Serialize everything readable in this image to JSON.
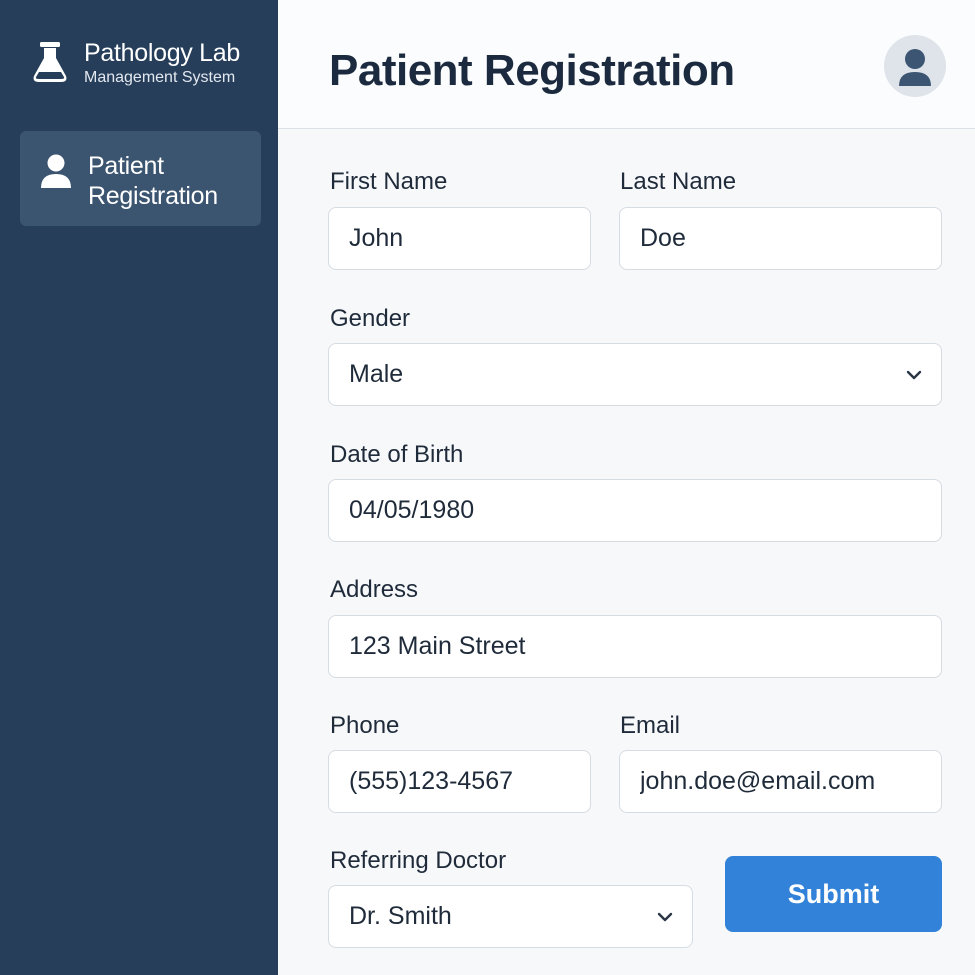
{
  "sidebar": {
    "brand": {
      "title": "Pathology Lab",
      "subtitle": "Management System",
      "icon": "flask-icon"
    },
    "nav": [
      {
        "label": "Patient Registration",
        "icon": "user-icon",
        "active": true
      }
    ]
  },
  "header": {
    "title": "Patient Registration",
    "avatar_icon": "user-avatar-icon"
  },
  "form": {
    "first_name": {
      "label": "First Name",
      "value": "John"
    },
    "last_name": {
      "label": "Last Name",
      "value": "Doe"
    },
    "gender": {
      "label": "Gender",
      "value": "Male"
    },
    "dob": {
      "label": "Date of Birth",
      "value": "04/05/1980"
    },
    "address": {
      "label": "Address",
      "value": "123 Main Street"
    },
    "phone": {
      "label": "Phone",
      "value": "(555)123-4567"
    },
    "email": {
      "label": "Email",
      "value": "john.doe@email.com"
    },
    "doctor": {
      "label": "Referring Doctor",
      "value": "Dr. Smith"
    },
    "submit_label": "Submit"
  },
  "colors": {
    "sidebar_bg": "#263e5a",
    "nav_active_bg": "#3b5470",
    "accent": "#3182d8",
    "title_text": "#1b2a3e"
  }
}
